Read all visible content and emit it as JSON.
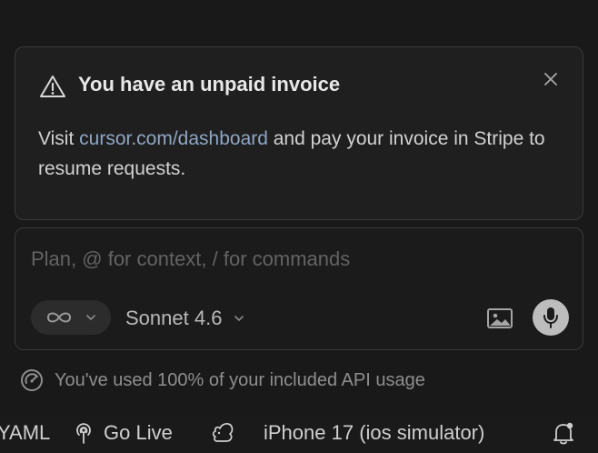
{
  "notice": {
    "title": "You have an unpaid invoice",
    "body_prefix": "Visit ",
    "link_text": "cursor.com/dashboard",
    "body_suffix": " and pay your invoice in Stripe to resume requests.",
    "icons": {
      "warning": "warning-triangle-icon",
      "close": "close-icon"
    }
  },
  "composer": {
    "placeholder": "Plan, @ for context, / for commands",
    "value": "",
    "mode_icon": "infinity-icon",
    "model": "Sonnet 4.6",
    "icons": {
      "image": "image-icon",
      "mic": "microphone-icon"
    }
  },
  "usage": {
    "text": "You've used 100% of your included API usage",
    "icon": "gauge-icon"
  },
  "statusbar": {
    "yaml": "YAML",
    "go_live": "Go Live",
    "device": "iPhone 17 (ios simulator)",
    "icons": {
      "go_live": "broadcast-icon",
      "extension": "squirrel-icon",
      "notifications": "bell-icon"
    }
  },
  "colors": {
    "background": "#191919",
    "card": "#1f1f1f",
    "border": "#3a3a3a",
    "link": "#8fa6c4",
    "placeholder": "#636363"
  }
}
